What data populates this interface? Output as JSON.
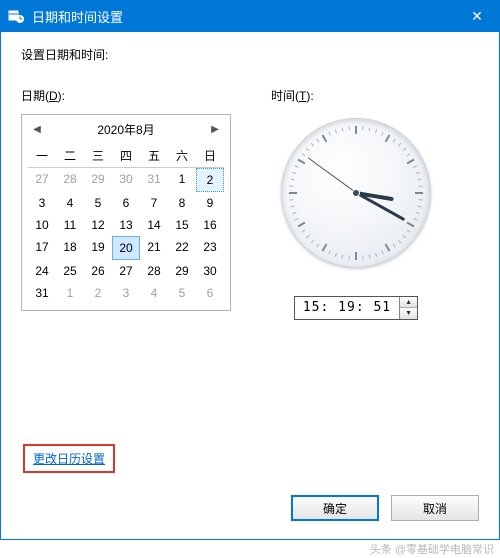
{
  "titlebar": {
    "title": "日期和时间设置",
    "close_icon": "✕"
  },
  "instruction": "设置日期和时间:",
  "date": {
    "label_prefix": "日期(",
    "label_mnemonic": "D",
    "label_suffix": "):",
    "month_year": "2020年8月",
    "prev_icon": "◀",
    "next_icon": "▶",
    "dow": [
      "一",
      "二",
      "三",
      "四",
      "五",
      "六",
      "日"
    ],
    "weeks": [
      [
        {
          "d": "27",
          "m": true
        },
        {
          "d": "28",
          "m": true
        },
        {
          "d": "29",
          "m": true
        },
        {
          "d": "30",
          "m": true
        },
        {
          "d": "31",
          "m": true
        },
        {
          "d": "1"
        },
        {
          "d": "2",
          "today": true
        }
      ],
      [
        {
          "d": "3"
        },
        {
          "d": "4"
        },
        {
          "d": "5"
        },
        {
          "d": "6"
        },
        {
          "d": "7"
        },
        {
          "d": "8"
        },
        {
          "d": "9"
        }
      ],
      [
        {
          "d": "10"
        },
        {
          "d": "11"
        },
        {
          "d": "12"
        },
        {
          "d": "13"
        },
        {
          "d": "14"
        },
        {
          "d": "15"
        },
        {
          "d": "16"
        }
      ],
      [
        {
          "d": "17"
        },
        {
          "d": "18"
        },
        {
          "d": "19"
        },
        {
          "d": "20",
          "sel": true
        },
        {
          "d": "21"
        },
        {
          "d": "22"
        },
        {
          "d": "23"
        }
      ],
      [
        {
          "d": "24"
        },
        {
          "d": "25"
        },
        {
          "d": "26"
        },
        {
          "d": "27"
        },
        {
          "d": "28"
        },
        {
          "d": "29"
        },
        {
          "d": "30"
        }
      ],
      [
        {
          "d": "31"
        },
        {
          "d": "1",
          "m": true
        },
        {
          "d": "2",
          "m": true
        },
        {
          "d": "3",
          "m": true
        },
        {
          "d": "4",
          "m": true
        },
        {
          "d": "5",
          "m": true
        },
        {
          "d": "6",
          "m": true
        }
      ]
    ]
  },
  "time": {
    "label_prefix": "时间(",
    "label_mnemonic": "T",
    "label_suffix": "):",
    "value": "15: 19: 51",
    "hours": 15,
    "minutes": 19,
    "seconds": 51,
    "up_icon": "▲",
    "down_icon": "▼"
  },
  "link": {
    "label": "更改日历设置"
  },
  "buttons": {
    "ok": "确定",
    "cancel": "取消"
  },
  "watermark": "头条 @零基础学电脑常识"
}
